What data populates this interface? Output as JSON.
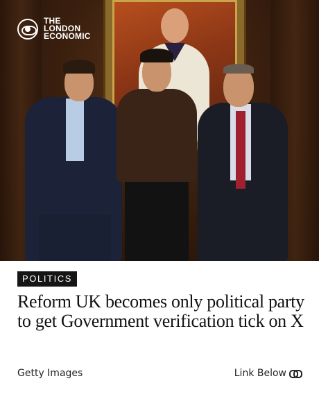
{
  "brand": {
    "line1": "THE",
    "line2": "LONDON",
    "line3": "ECONOMIC",
    "logo_icon": "eye-icon"
  },
  "photo": {
    "subject": "photograph"
  },
  "article": {
    "category": "POLITICS",
    "headline": "Reform UK becomes only political party to get Government verification tick on X",
    "credit": "Getty Images",
    "link_label": "Link Below",
    "link_icon": "link-icon"
  }
}
